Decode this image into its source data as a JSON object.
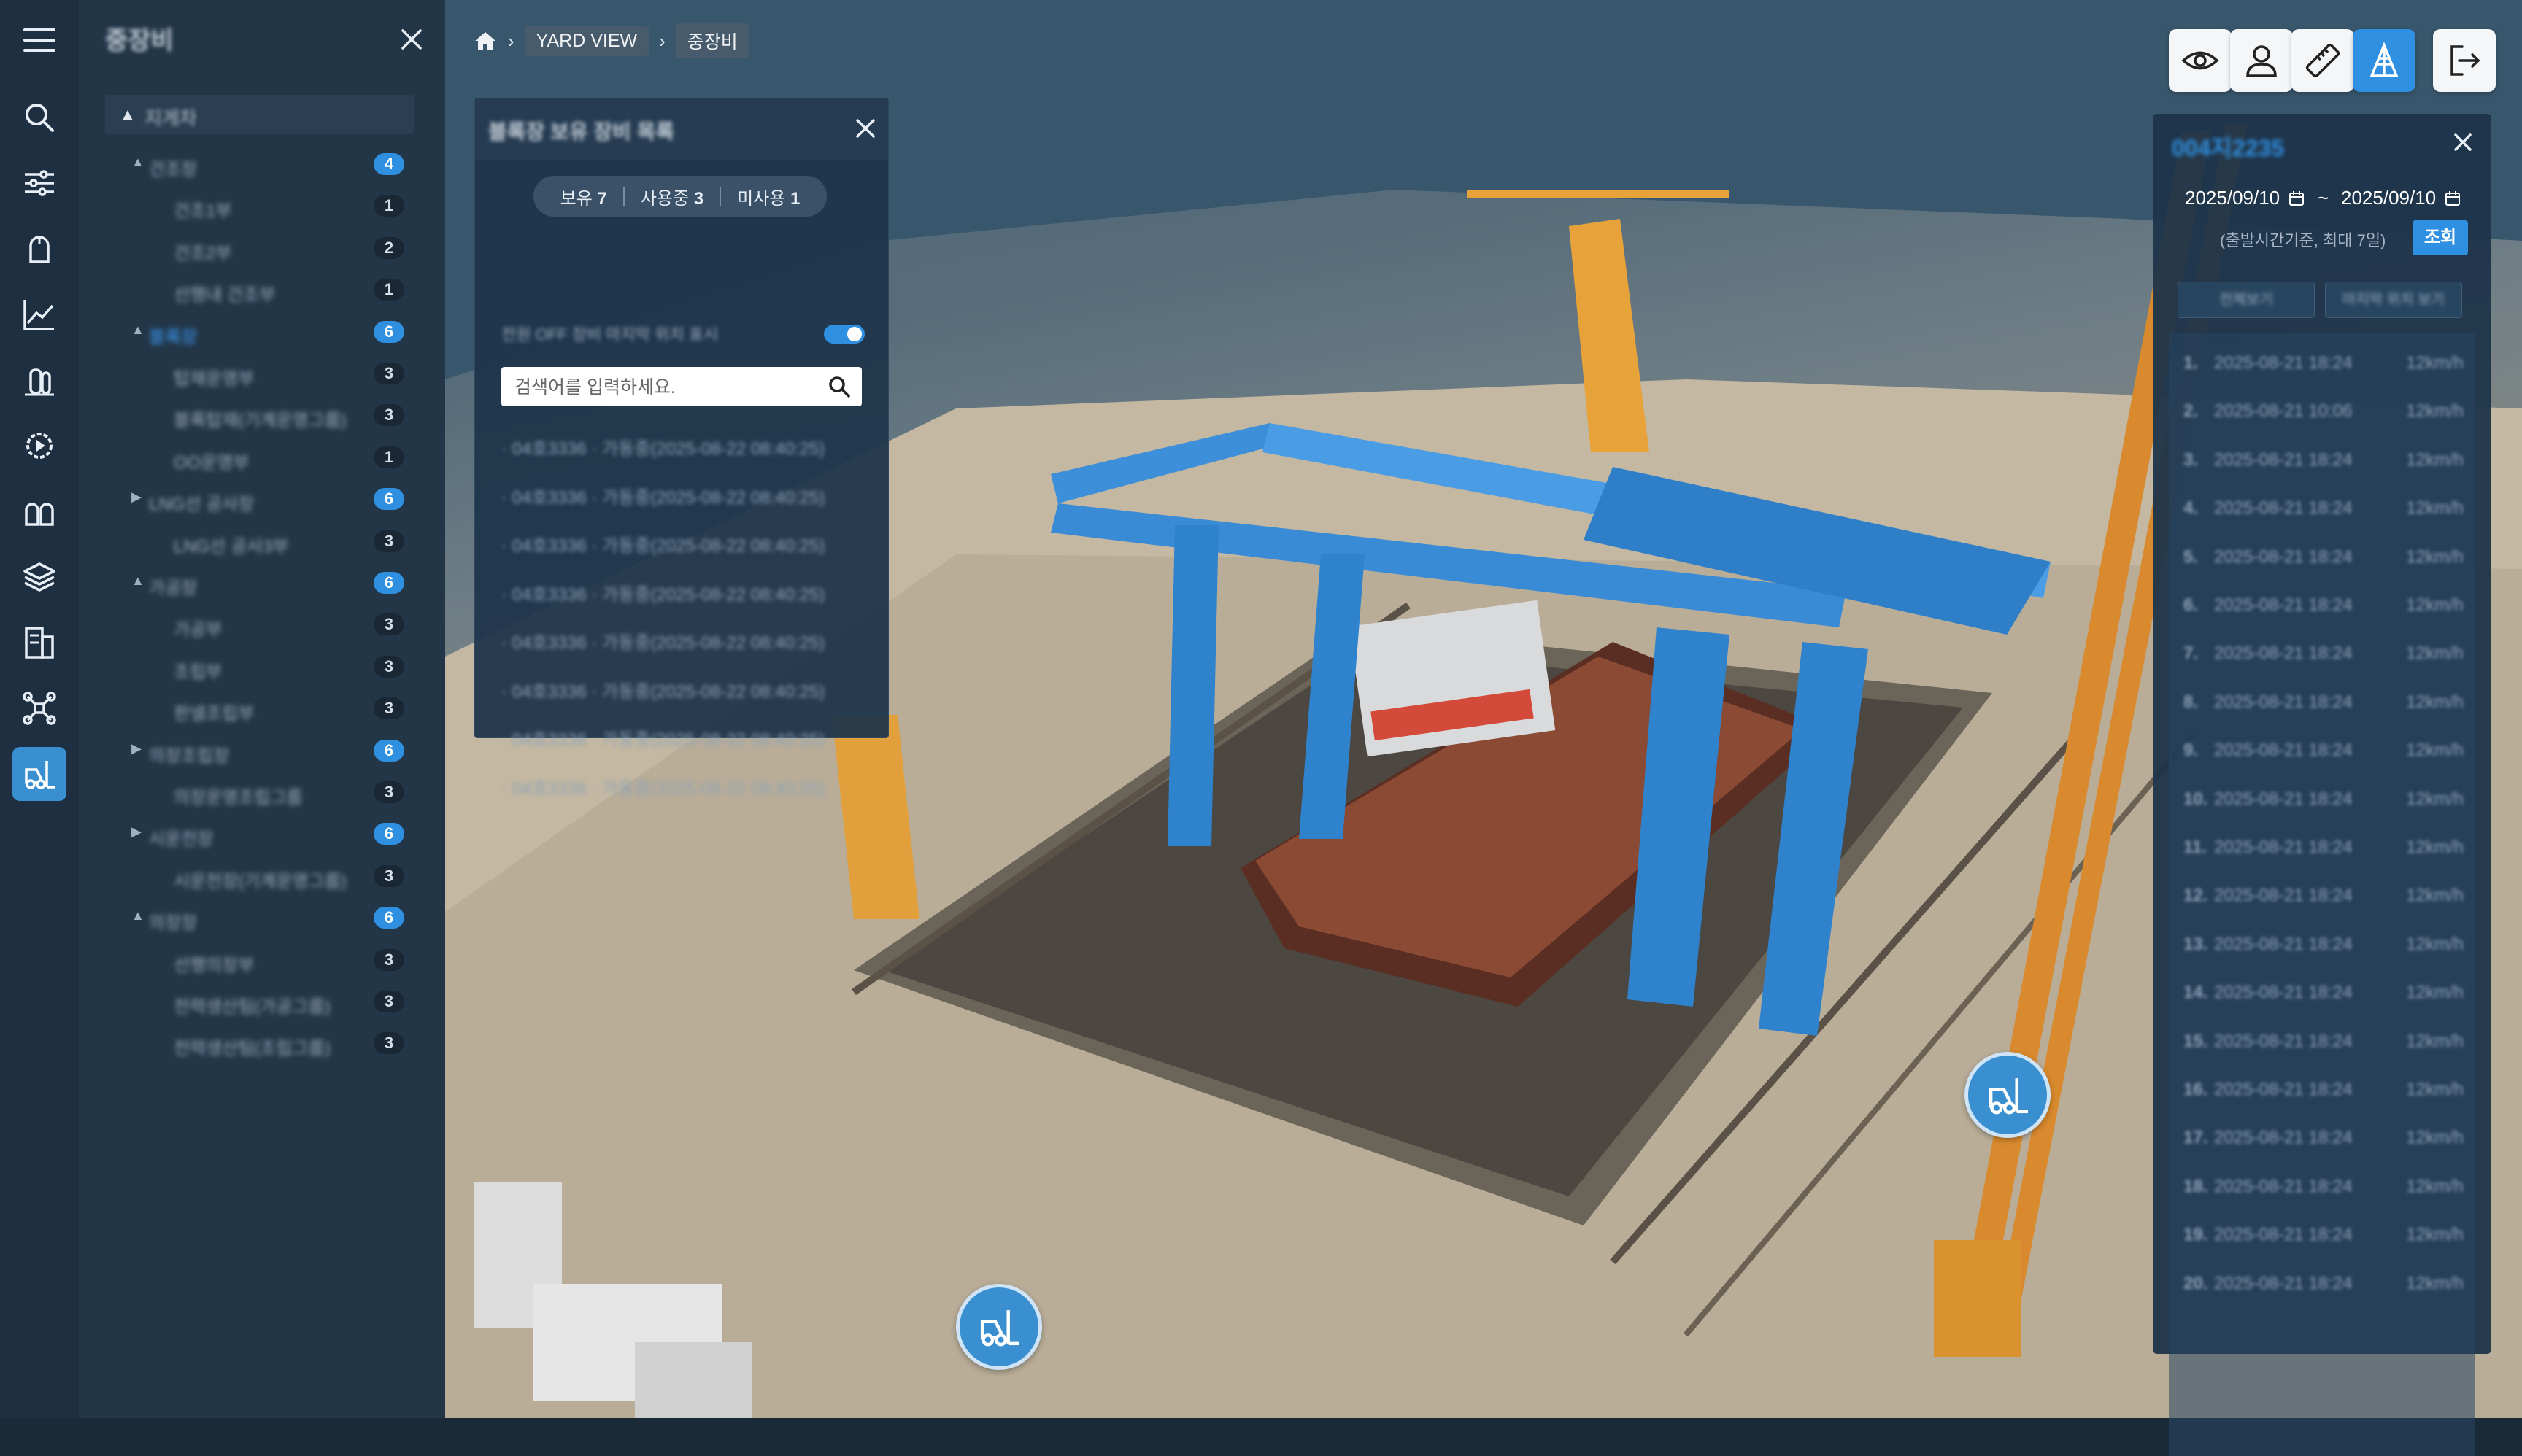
{
  "rail": {
    "icons": [
      "menu-icon",
      "search-icon",
      "sliders-icon",
      "helmet-icon",
      "chart-icon",
      "gas-cylinder-icon",
      "gear-play-icon",
      "safety-gear-icon",
      "layers-icon",
      "report-icon",
      "drone-icon",
      "forklift-icon"
    ],
    "active": "forklift-icon"
  },
  "tree": {
    "title": "중장비",
    "root": "지게차",
    "items": [
      {
        "label": "건조장",
        "count": "4",
        "depth": 1,
        "expanded": true,
        "badge": "blue"
      },
      {
        "label": "건조1부",
        "count": "1",
        "depth": 2,
        "badge": "dark"
      },
      {
        "label": "건조2부",
        "count": "2",
        "depth": 2,
        "badge": "dark"
      },
      {
        "label": "선행내 건조부",
        "count": "1",
        "depth": 2,
        "badge": "dark"
      },
      {
        "label": "블록장",
        "count": "6",
        "depth": 1,
        "expanded": true,
        "badge": "blue",
        "selected": true
      },
      {
        "label": "탑재운영부",
        "count": "3",
        "depth": 2,
        "badge": "dark"
      },
      {
        "label": "블록탑재(기계운영그룹)",
        "count": "3",
        "depth": 2,
        "badge": "dark"
      },
      {
        "label": "OO운영부",
        "count": "1",
        "depth": 2,
        "badge": "dark"
      },
      {
        "label": "LNG선 공사장",
        "count": "6",
        "depth": 1,
        "expanded": false,
        "badge": "blue"
      },
      {
        "label": "LNG선 공사3부",
        "count": "3",
        "depth": 2,
        "badge": "dark"
      },
      {
        "label": "가공장",
        "count": "6",
        "depth": 1,
        "expanded": true,
        "badge": "blue"
      },
      {
        "label": "가공부",
        "count": "3",
        "depth": 2,
        "badge": "dark"
      },
      {
        "label": "조립부",
        "count": "3",
        "depth": 2,
        "badge": "dark"
      },
      {
        "label": "판넬조립부",
        "count": "3",
        "depth": 2,
        "badge": "dark"
      },
      {
        "label": "의장조립장",
        "count": "6",
        "depth": 1,
        "expanded": false,
        "badge": "blue"
      },
      {
        "label": "의장운영조립그룹",
        "count": "3",
        "depth": 2,
        "badge": "dark"
      },
      {
        "label": "시운전장",
        "count": "6",
        "depth": 1,
        "expanded": false,
        "badge": "blue"
      },
      {
        "label": "시운전장(기계운영그룹)",
        "count": "3",
        "depth": 2,
        "badge": "dark"
      },
      {
        "label": "의장장",
        "count": "6",
        "depth": 1,
        "expanded": true,
        "badge": "blue"
      },
      {
        "label": "선행의장부",
        "count": "3",
        "depth": 2,
        "badge": "dark"
      },
      {
        "label": "전력생산팀(가공그룹)",
        "count": "3",
        "depth": 2,
        "badge": "dark"
      },
      {
        "label": "전력생산팀(조립그룹)",
        "count": "3",
        "depth": 2,
        "badge": "dark"
      }
    ]
  },
  "breadcrumb": {
    "home": "home-icon",
    "items": [
      "YARD VIEW",
      "중장비"
    ]
  },
  "equipment": {
    "title": "블록장 보유 장비 목록",
    "segments": [
      {
        "label": "보유",
        "count": "7"
      },
      {
        "label": "사용중",
        "count": "3"
      },
      {
        "label": "미사용",
        "count": "1"
      }
    ],
    "toggle_label": "전원 OFF 장비 마지막 위치 표시",
    "toggle_on": true,
    "search_placeholder": "검색어를 입력하세요.",
    "rows": [
      "· 04호3336 · 가동중(2025-08-22 08:40:25)",
      "· 04호3336 · 가동중(2025-08-22 08:40:25)",
      "· 04호3336 · 가동중(2025-08-22 08:40:25)",
      "· 04호3336 · 가동중(2025-08-22 08:40:25)",
      "· 04호3336 · 가동중(2025-08-22 08:40:25)",
      "· 04호3336 · 가동중(2025-08-22 08:40:25)",
      "· 04호3336 · 가동중(2025-08-22 08:40:25)",
      "· 04호3336 · 가동중(2025-08-22 08:40:25)"
    ]
  },
  "toolbar": {
    "buttons": [
      "eye-icon",
      "user-icon",
      "ruler-icon",
      "crane-icon",
      "logout-icon"
    ],
    "active": "crane-icon"
  },
  "track": {
    "title": "004지2235",
    "date_from": "2025/09/10",
    "date_to": "2025/09/10",
    "separator": "~",
    "hint": "(출발시간기준, 최대 7일)",
    "query_label": "조회",
    "tabs": [
      "전체보기",
      "마지막 위치 보기"
    ],
    "rows": [
      {
        "n": "1.",
        "d": "2025-08-21 18:24",
        "s": "12km/h"
      },
      {
        "n": "2.",
        "d": "2025-08-21 10:06",
        "s": "12km/h"
      },
      {
        "n": "3.",
        "d": "2025-08-21 18:24",
        "s": "12km/h"
      },
      {
        "n": "4.",
        "d": "2025-08-21 18:24",
        "s": "12km/h"
      },
      {
        "n": "5.",
        "d": "2025-08-21 18:24",
        "s": "12km/h"
      },
      {
        "n": "6.",
        "d": "2025-08-21 18:24",
        "s": "12km/h"
      },
      {
        "n": "7.",
        "d": "2025-08-21 18:24",
        "s": "12km/h"
      },
      {
        "n": "8.",
        "d": "2025-08-21 18:24",
        "s": "12km/h"
      },
      {
        "n": "9.",
        "d": "2025-08-21 18:24",
        "s": "12km/h"
      },
      {
        "n": "10.",
        "d": "2025-08-21 18:24",
        "s": "12km/h"
      },
      {
        "n": "11.",
        "d": "2025-08-21 18:24",
        "s": "12km/h"
      },
      {
        "n": "12.",
        "d": "2025-08-21 18:24",
        "s": "12km/h"
      },
      {
        "n": "13.",
        "d": "2025-08-21 18:24",
        "s": "12km/h"
      },
      {
        "n": "14.",
        "d": "2025-08-21 18:24",
        "s": "12km/h"
      },
      {
        "n": "15.",
        "d": "2025-08-21 18:24",
        "s": "12km/h"
      },
      {
        "n": "16.",
        "d": "2025-08-21 18:24",
        "s": "12km/h"
      },
      {
        "n": "17.",
        "d": "2025-08-21 18:24",
        "s": "12km/h"
      },
      {
        "n": "18.",
        "d": "2025-08-21 18:24",
        "s": "12km/h"
      },
      {
        "n": "19.",
        "d": "2025-08-21 18:24",
        "s": "12km/h"
      },
      {
        "n": "20.",
        "d": "2025-08-21 18:24",
        "s": "12km/h"
      }
    ]
  },
  "map_markers": [
    "forklift-marker-icon",
    "forklift-marker-icon"
  ],
  "colors": {
    "accent": "#2f8fe0",
    "rail_bg": "#1d2f40",
    "panel_bg": "#233648"
  }
}
